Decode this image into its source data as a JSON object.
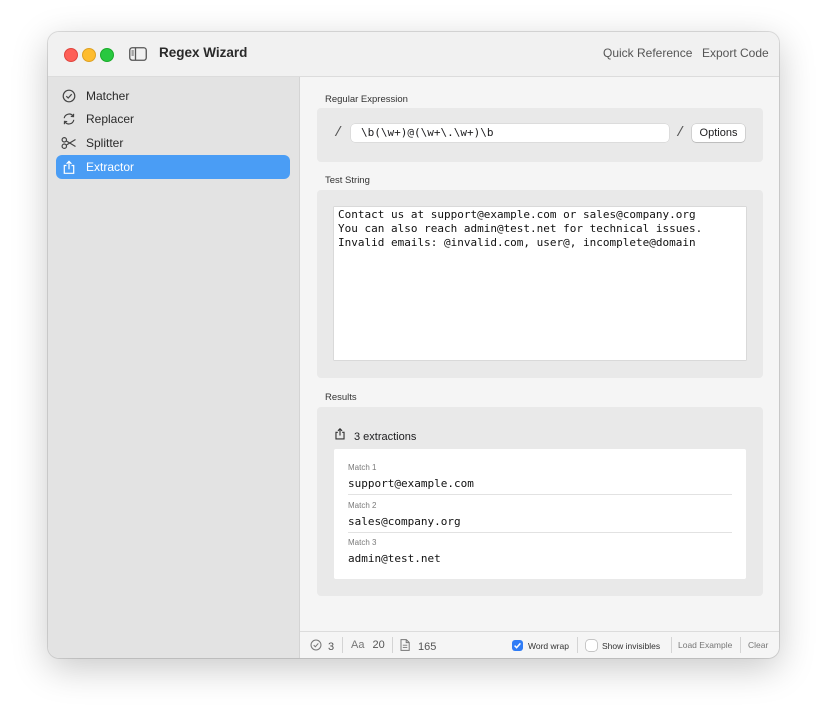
{
  "app": {
    "title": "Regex Wizard"
  },
  "toolbar": {
    "quick_reference": "Quick Reference",
    "export_code": "Export Code"
  },
  "sidebar": {
    "items": [
      {
        "label": "Matcher",
        "icon": "checkmark-circle-icon",
        "active": false
      },
      {
        "label": "Replacer",
        "icon": "arrows-circle-icon",
        "active": false
      },
      {
        "label": "Splitter",
        "icon": "scissors-icon",
        "active": false
      },
      {
        "label": "Extractor",
        "icon": "share-box-icon",
        "active": true
      }
    ]
  },
  "regex": {
    "section_label": "Regular Expression",
    "delimiter_open": "/",
    "delimiter_close": "/",
    "pattern": "\\b(\\w+)@(\\w+\\.\\w+)\\b",
    "options_label": "Options"
  },
  "test": {
    "section_label": "Test String",
    "lines": [
      "Contact us at support@example.com or sales@company.org",
      "You can also reach admin@test.net for technical issues.",
      "Invalid emails: @invalid.com, user@, incomplete@domain"
    ]
  },
  "results": {
    "section_label": "Results",
    "summary": "3 extractions",
    "matches": [
      {
        "label": "Match 1",
        "value": "support@example.com"
      },
      {
        "label": "Match 2",
        "value": "sales@company.org"
      },
      {
        "label": "Match 3",
        "value": "admin@test.net"
      }
    ]
  },
  "status": {
    "match_count": "3",
    "aa_label": "Aa",
    "group_count": "20",
    "char_count": "165",
    "word_wrap_label": "Word wrap",
    "word_wrap_checked": true,
    "show_invisibles_label": "Show invisibles",
    "show_invisibles_checked": false,
    "load_example_label": "Load Example",
    "clear_label": "Clear"
  },
  "colors": {
    "accent": "#4a9df5",
    "checkbox_blue": "#2f7cf6",
    "close": "#fe5f57",
    "minimize": "#febc2e",
    "zoom": "#28c840"
  }
}
